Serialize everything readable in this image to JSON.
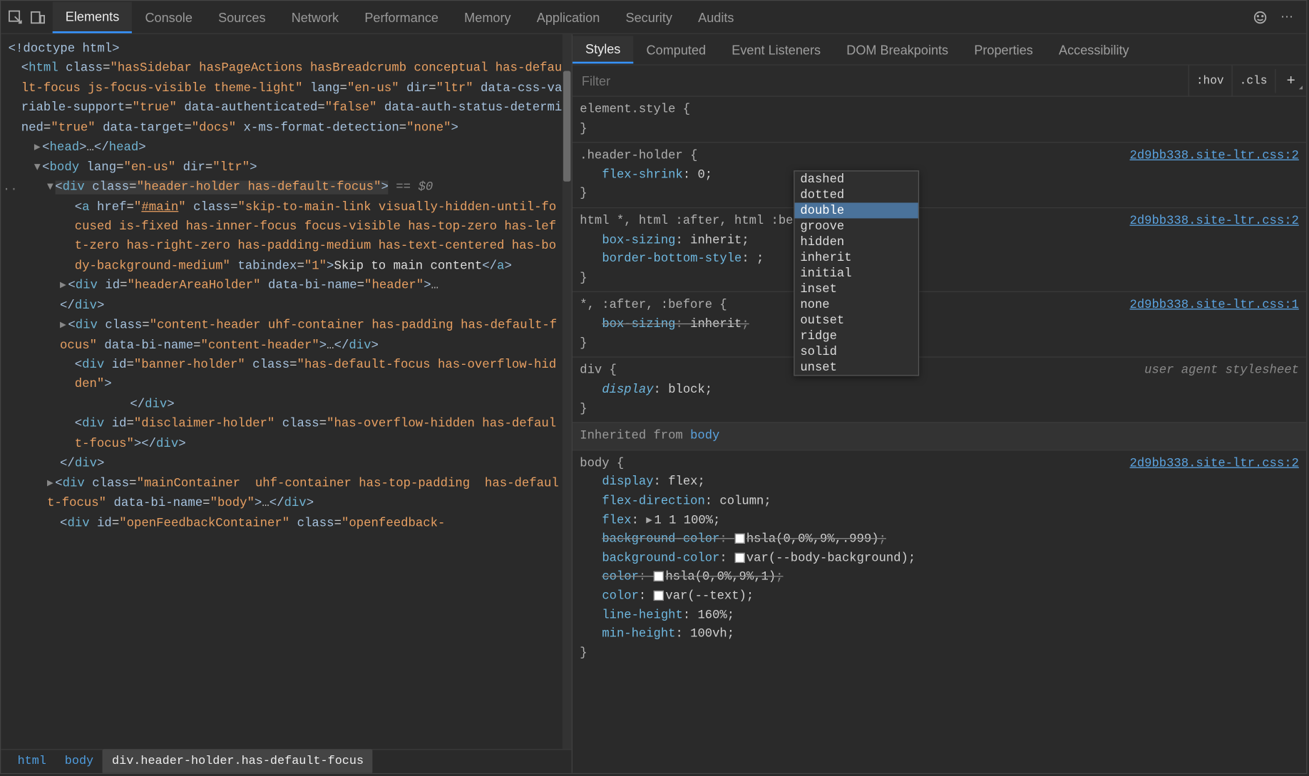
{
  "main_tabs": [
    "Elements",
    "Console",
    "Sources",
    "Network",
    "Performance",
    "Memory",
    "Application",
    "Security",
    "Audits"
  ],
  "main_tab_active": 0,
  "styles_tabs": [
    "Styles",
    "Computed",
    "Event Listeners",
    "DOM Breakpoints",
    "Properties",
    "Accessibility"
  ],
  "styles_tab_active": 0,
  "filter_placeholder": "Filter",
  "hov_label": ":hov",
  "cls_label": ".cls",
  "dom_tree": {
    "doctype": "<!doctype html>",
    "html_open": "<html class=\"hasSidebar hasPageActions hasBreadcrumb conceptual has-default-focus js-focus-visible theme-light\" lang=\"en-us\" dir=\"ltr\" data-css-variable-support=\"true\" data-authenticated=\"false\" data-auth-status-determined=\"true\" data-target=\"docs\" x-ms-format-detection=\"none\">",
    "head": "<head>…</head>",
    "body_open": "<body lang=\"en-us\" dir=\"ltr\">",
    "header_holder": "<div class=\"header-holder has-default-focus\">",
    "header_holder_annot": "== $0",
    "a_skip": "<a href=\"#main\" class=\"skip-to-main-link visually-hidden-until-focused is-fixed has-inner-focus focus-visible has-top-zero has-left-zero has-right-zero has-padding-medium has-text-centered has-body-background-medium\" tabindex=\"1\">Skip to main content</a>",
    "header_area": "<div id=\"headerAreaHolder\" data-bi-name=\"header\">…</div>",
    "header_close": "</div>",
    "content_header": "<div class=\"content-header uhf-container has-padding has-default-focus\" data-bi-name=\"content-header\">…</div>",
    "banner_holder_open": "<div id=\"banner-holder\" class=\"has-default-focus has-overflow-hidden\">",
    "banner_holder_close": "</div>",
    "disclaimer": "<div id=\"disclaimer-holder\" class=\"has-overflow-hidden has-default-focus\"></div>",
    "outer_close": "</div>",
    "main_container": "<div class=\"mainContainer  uhf-container has-top-padding  has-default-focus\" data-bi-name=\"body\">…</div>",
    "feedback": "<div id=\"openFeedbackContainer\" class=\"openfeedback-"
  },
  "crumbs": [
    "html",
    "body",
    "div.header-holder.has-default-focus"
  ],
  "crumb_selected": 2,
  "styles_rules": [
    {
      "selector": "element.style",
      "props": []
    },
    {
      "selector": ".header-holder",
      "props": [
        {
          "n": "flex-shrink",
          "v": "0"
        }
      ],
      "source": "2d9bb338.site-ltr.css:2"
    },
    {
      "selector": "html *, html :after, html :before",
      "props": [
        {
          "n": "box-sizing",
          "v": "inherit"
        },
        {
          "n": "border-bottom-style",
          "v": "",
          "editing": true
        }
      ],
      "source": "2d9bb338.site-ltr.css:2"
    },
    {
      "selector": "*, :after, :before",
      "props": [
        {
          "n": "box-sizing",
          "v": "inherit",
          "strike": true
        }
      ],
      "source": "2d9bb338.site-ltr.css:1"
    },
    {
      "selector": "div",
      "ua": true,
      "props": [
        {
          "n": "display",
          "v": "block",
          "ua": true
        }
      ]
    }
  ],
  "inherited_from_label": "Inherited from",
  "inherited_from_target": "body",
  "inherited_rules": [
    {
      "selector": "body",
      "source": "2d9bb338.site-ltr.css:2",
      "props": [
        {
          "n": "display",
          "v": "flex"
        },
        {
          "n": "flex-direction",
          "v": "column"
        },
        {
          "n": "flex",
          "v": "1 1 100%",
          "tri": true
        },
        {
          "n": "background-color",
          "v": "hsla(0,0%,9%,.999)",
          "strike": true,
          "swatch": true,
          "obscured": true
        },
        {
          "n": "background-color",
          "v": "var(--body-background)",
          "swatch": true,
          "obscured": true
        },
        {
          "n": "color",
          "v": "hsla(0,0%,9%,1)",
          "strike": true,
          "swatch": true
        },
        {
          "n": "color",
          "v": "var(--text)",
          "swatch": true
        },
        {
          "n": "line-height",
          "v": "160%"
        },
        {
          "n": "min-height",
          "v": "100vh"
        }
      ]
    }
  ],
  "autocomplete": {
    "items": [
      "dashed",
      "dotted",
      "double",
      "groove",
      "hidden",
      "inherit",
      "initial",
      "inset",
      "none",
      "outset",
      "ridge",
      "solid",
      "unset"
    ],
    "selected": 2
  },
  "ua_label": "user agent stylesheet"
}
